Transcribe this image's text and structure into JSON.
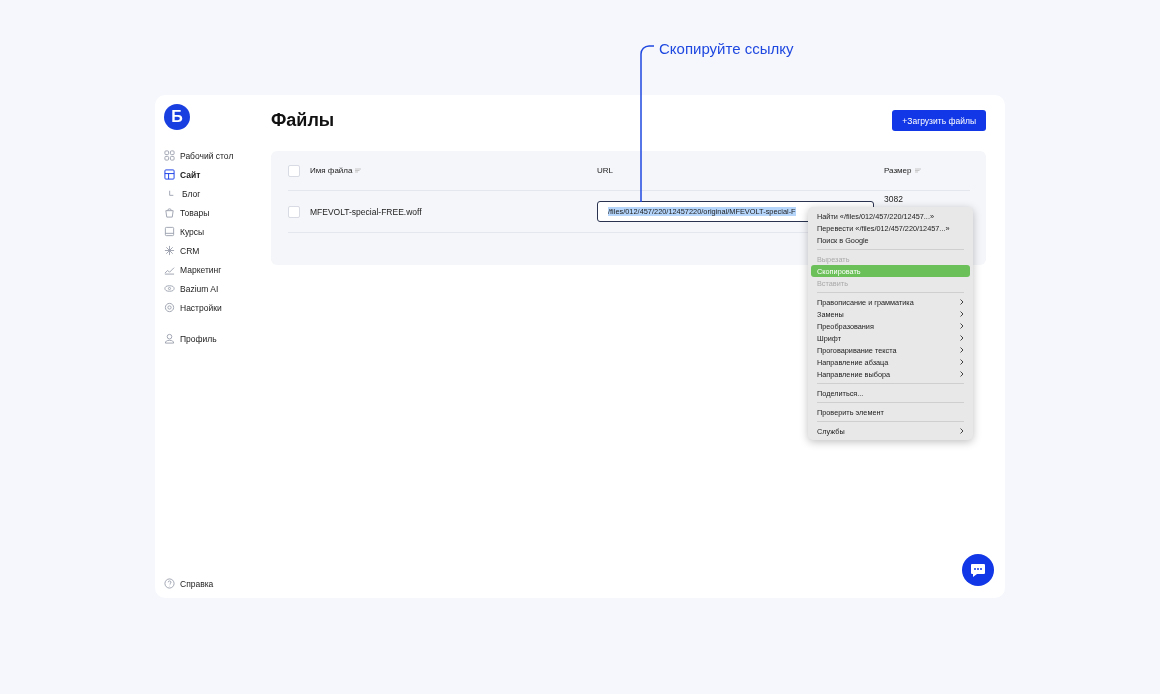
{
  "callout": {
    "text": "Скопируйте ссылку"
  },
  "sidebar": {
    "logo": "Б",
    "items": [
      {
        "label": "Рабочий стол",
        "selected": false,
        "sub": false
      },
      {
        "label": "Сайт",
        "selected": true,
        "sub": false
      },
      {
        "label": "Блог",
        "selected": false,
        "sub": true
      },
      {
        "label": "Товары",
        "selected": false,
        "sub": false
      },
      {
        "label": "Курсы",
        "selected": false,
        "sub": false
      },
      {
        "label": "CRM",
        "selected": false,
        "sub": false
      },
      {
        "label": "Маркетинг",
        "selected": false,
        "sub": false
      },
      {
        "label": "Bazium AI",
        "selected": false,
        "sub": false
      },
      {
        "label": "Настройки",
        "selected": false,
        "sub": false
      }
    ],
    "profile": "Профиль",
    "help": "Справка"
  },
  "page": {
    "title": "Файлы",
    "upload_button": "+Загрузить файлы"
  },
  "table": {
    "header_checked": false,
    "columns": [
      {
        "label": "Имя файла",
        "sortable": true
      },
      {
        "label": "URL",
        "sortable": false
      },
      {
        "label": "Размер",
        "sortable": true
      }
    ],
    "rows": [
      {
        "checked": false,
        "name": "MFEVOLT-special-FREE.woff",
        "url": "/files/012/457/220/12457220/original/MFEVOLT-special-F",
        "size": "3082"
      }
    ]
  },
  "context_menu": {
    "items": [
      {
        "kind": "item",
        "label": "Найти «/files/012/457/220/12457...»",
        "disabled": false,
        "selected": false,
        "submenu": false
      },
      {
        "kind": "item",
        "label": "Перевести «/files/012/457/220/12457...»",
        "disabled": false,
        "selected": false,
        "submenu": false
      },
      {
        "kind": "item",
        "label": "Поиск в Google",
        "disabled": false,
        "selected": false,
        "submenu": false
      },
      {
        "kind": "separator"
      },
      {
        "kind": "item",
        "label": "Вырезать",
        "disabled": true,
        "selected": false,
        "submenu": false
      },
      {
        "kind": "item",
        "label": "Скопировать",
        "disabled": false,
        "selected": true,
        "submenu": false
      },
      {
        "kind": "item",
        "label": "Вставить",
        "disabled": true,
        "selected": false,
        "submenu": false
      },
      {
        "kind": "separator"
      },
      {
        "kind": "item",
        "label": "Правописание и грамматика",
        "disabled": false,
        "selected": false,
        "submenu": true
      },
      {
        "kind": "item",
        "label": "Замены",
        "disabled": false,
        "selected": false,
        "submenu": true
      },
      {
        "kind": "item",
        "label": "Преобразования",
        "disabled": false,
        "selected": false,
        "submenu": true
      },
      {
        "kind": "item",
        "label": "Шрифт",
        "disabled": false,
        "selected": false,
        "submenu": true
      },
      {
        "kind": "item",
        "label": "Проговаривание текста",
        "disabled": false,
        "selected": false,
        "submenu": true
      },
      {
        "kind": "item",
        "label": "Направление абзаца",
        "disabled": false,
        "selected": false,
        "submenu": true
      },
      {
        "kind": "item",
        "label": "Направление выбора",
        "disabled": false,
        "selected": false,
        "submenu": true
      },
      {
        "kind": "separator"
      },
      {
        "kind": "item",
        "label": "Поделиться...",
        "disabled": false,
        "selected": false,
        "submenu": false
      },
      {
        "kind": "separator"
      },
      {
        "kind": "item",
        "label": "Проверить элемент",
        "disabled": false,
        "selected": false,
        "submenu": false
      },
      {
        "kind": "separator"
      },
      {
        "kind": "item",
        "label": "Службы",
        "disabled": false,
        "selected": false,
        "submenu": true
      }
    ]
  }
}
